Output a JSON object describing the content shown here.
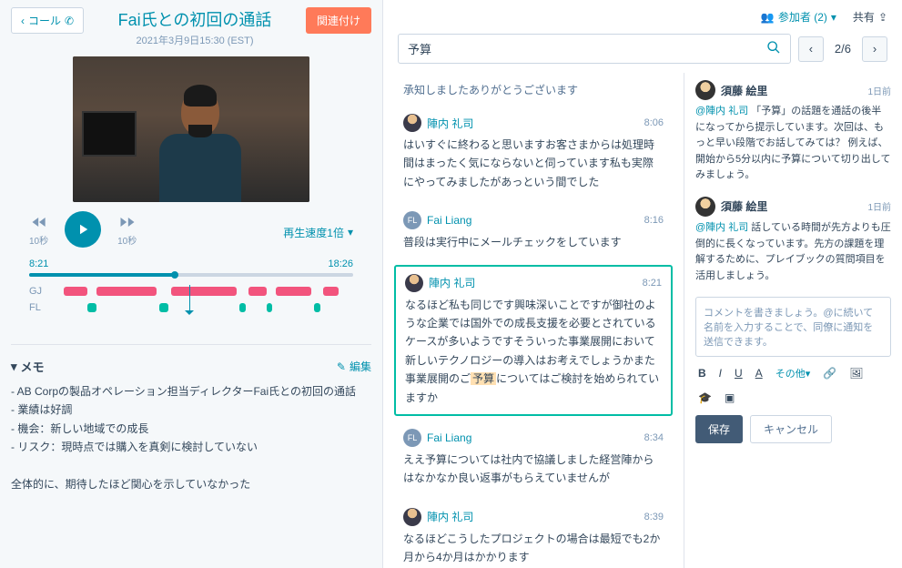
{
  "header": {
    "back_label": "コール",
    "title": "Fai氏との初回の通話",
    "subtitle": "2021年3月9日15:30 (EST)",
    "associate_label": "関連付け"
  },
  "player": {
    "skip_back": "10秒",
    "skip_fwd": "10秒",
    "speed_label": "再生速度1倍",
    "time_current": "8:21",
    "time_total": "18:26",
    "tracks": [
      {
        "label": "GJ"
      },
      {
        "label": "FL"
      }
    ]
  },
  "notes": {
    "section_label": "メモ",
    "edit_label": "編集",
    "lines": [
      "- AB Corpの製品オペレーション担当ディレクターFai氏との初回の通話",
      "- 業績は好調",
      "- 機会：新しい地域での成長",
      "- リスク：現時点では購入を真剣に検討していない",
      "",
      "全体的に、期待したほど関心を示していなかった"
    ]
  },
  "right_header": {
    "participants_label": "参加者 (2)",
    "share_label": "共有"
  },
  "search": {
    "value": "予算",
    "counter": "2/6"
  },
  "transcript": [
    {
      "type": "frag",
      "text": "承知しましたありがとうございます"
    },
    {
      "type": "msg",
      "avatar": "jn",
      "name": "陣内 礼司",
      "time": "8:06",
      "text": "はいすぐに終わると思いますお客さまからは処理時間はまったく気にならないと伺っています私も実際にやってみましたがあっという間でした"
    },
    {
      "type": "msg",
      "avatar": "fl",
      "name": "Fai Liang",
      "time": "8:16",
      "text": "普段は実行中にメールチェックをしています"
    },
    {
      "type": "msg",
      "avatar": "jn",
      "name": "陣内 礼司",
      "time": "8:21",
      "hl": true,
      "pre": "なるほど私も同じです興味深いことですが御社のような企業では国外での成長支援を必要とされているケースが多いようですそういった事業展開において新しいテクノロジーの導入はお考えでしょうかまた事業展開のご",
      "mark": "予算",
      "post": "についてはご検討を始められていますか"
    },
    {
      "type": "msg",
      "avatar": "fl",
      "name": "Fai Liang",
      "time": "8:34",
      "text": "ええ予算については社内で協議しました経営陣からはなかなか良い返事がもらえていませんが"
    },
    {
      "type": "msg",
      "avatar": "jn",
      "name": "陣内 礼司",
      "time": "8:39",
      "text": "なるほどこうしたプロジェクトの場合は最短でも2か月から4か月はかかります"
    }
  ],
  "comments": [
    {
      "name": "須藤 絵里",
      "time": "1日前",
      "mention": "@陣内 礼司",
      "text": " 「予算」の話題を通話の後半になってから提示しています。次回は、もっと早い段階でお話してみては？ 例えば、開始から5分以内に予算について切り出してみましょう。"
    },
    {
      "name": "須藤 絵里",
      "time": "1日前",
      "mention": "@陣内 礼司",
      "text": " 話している時間が先方よりも圧倒的に長くなっています。先方の課題を理解するために、プレイブックの質問項目を活用しましょう。"
    }
  ],
  "comment_box": {
    "placeholder": "コメントを書きましょう。@に続いて名前を入力することで、同僚に通知を送信できます。",
    "toolbar_more": "その他",
    "save": "保存",
    "cancel": "キャンセル"
  }
}
